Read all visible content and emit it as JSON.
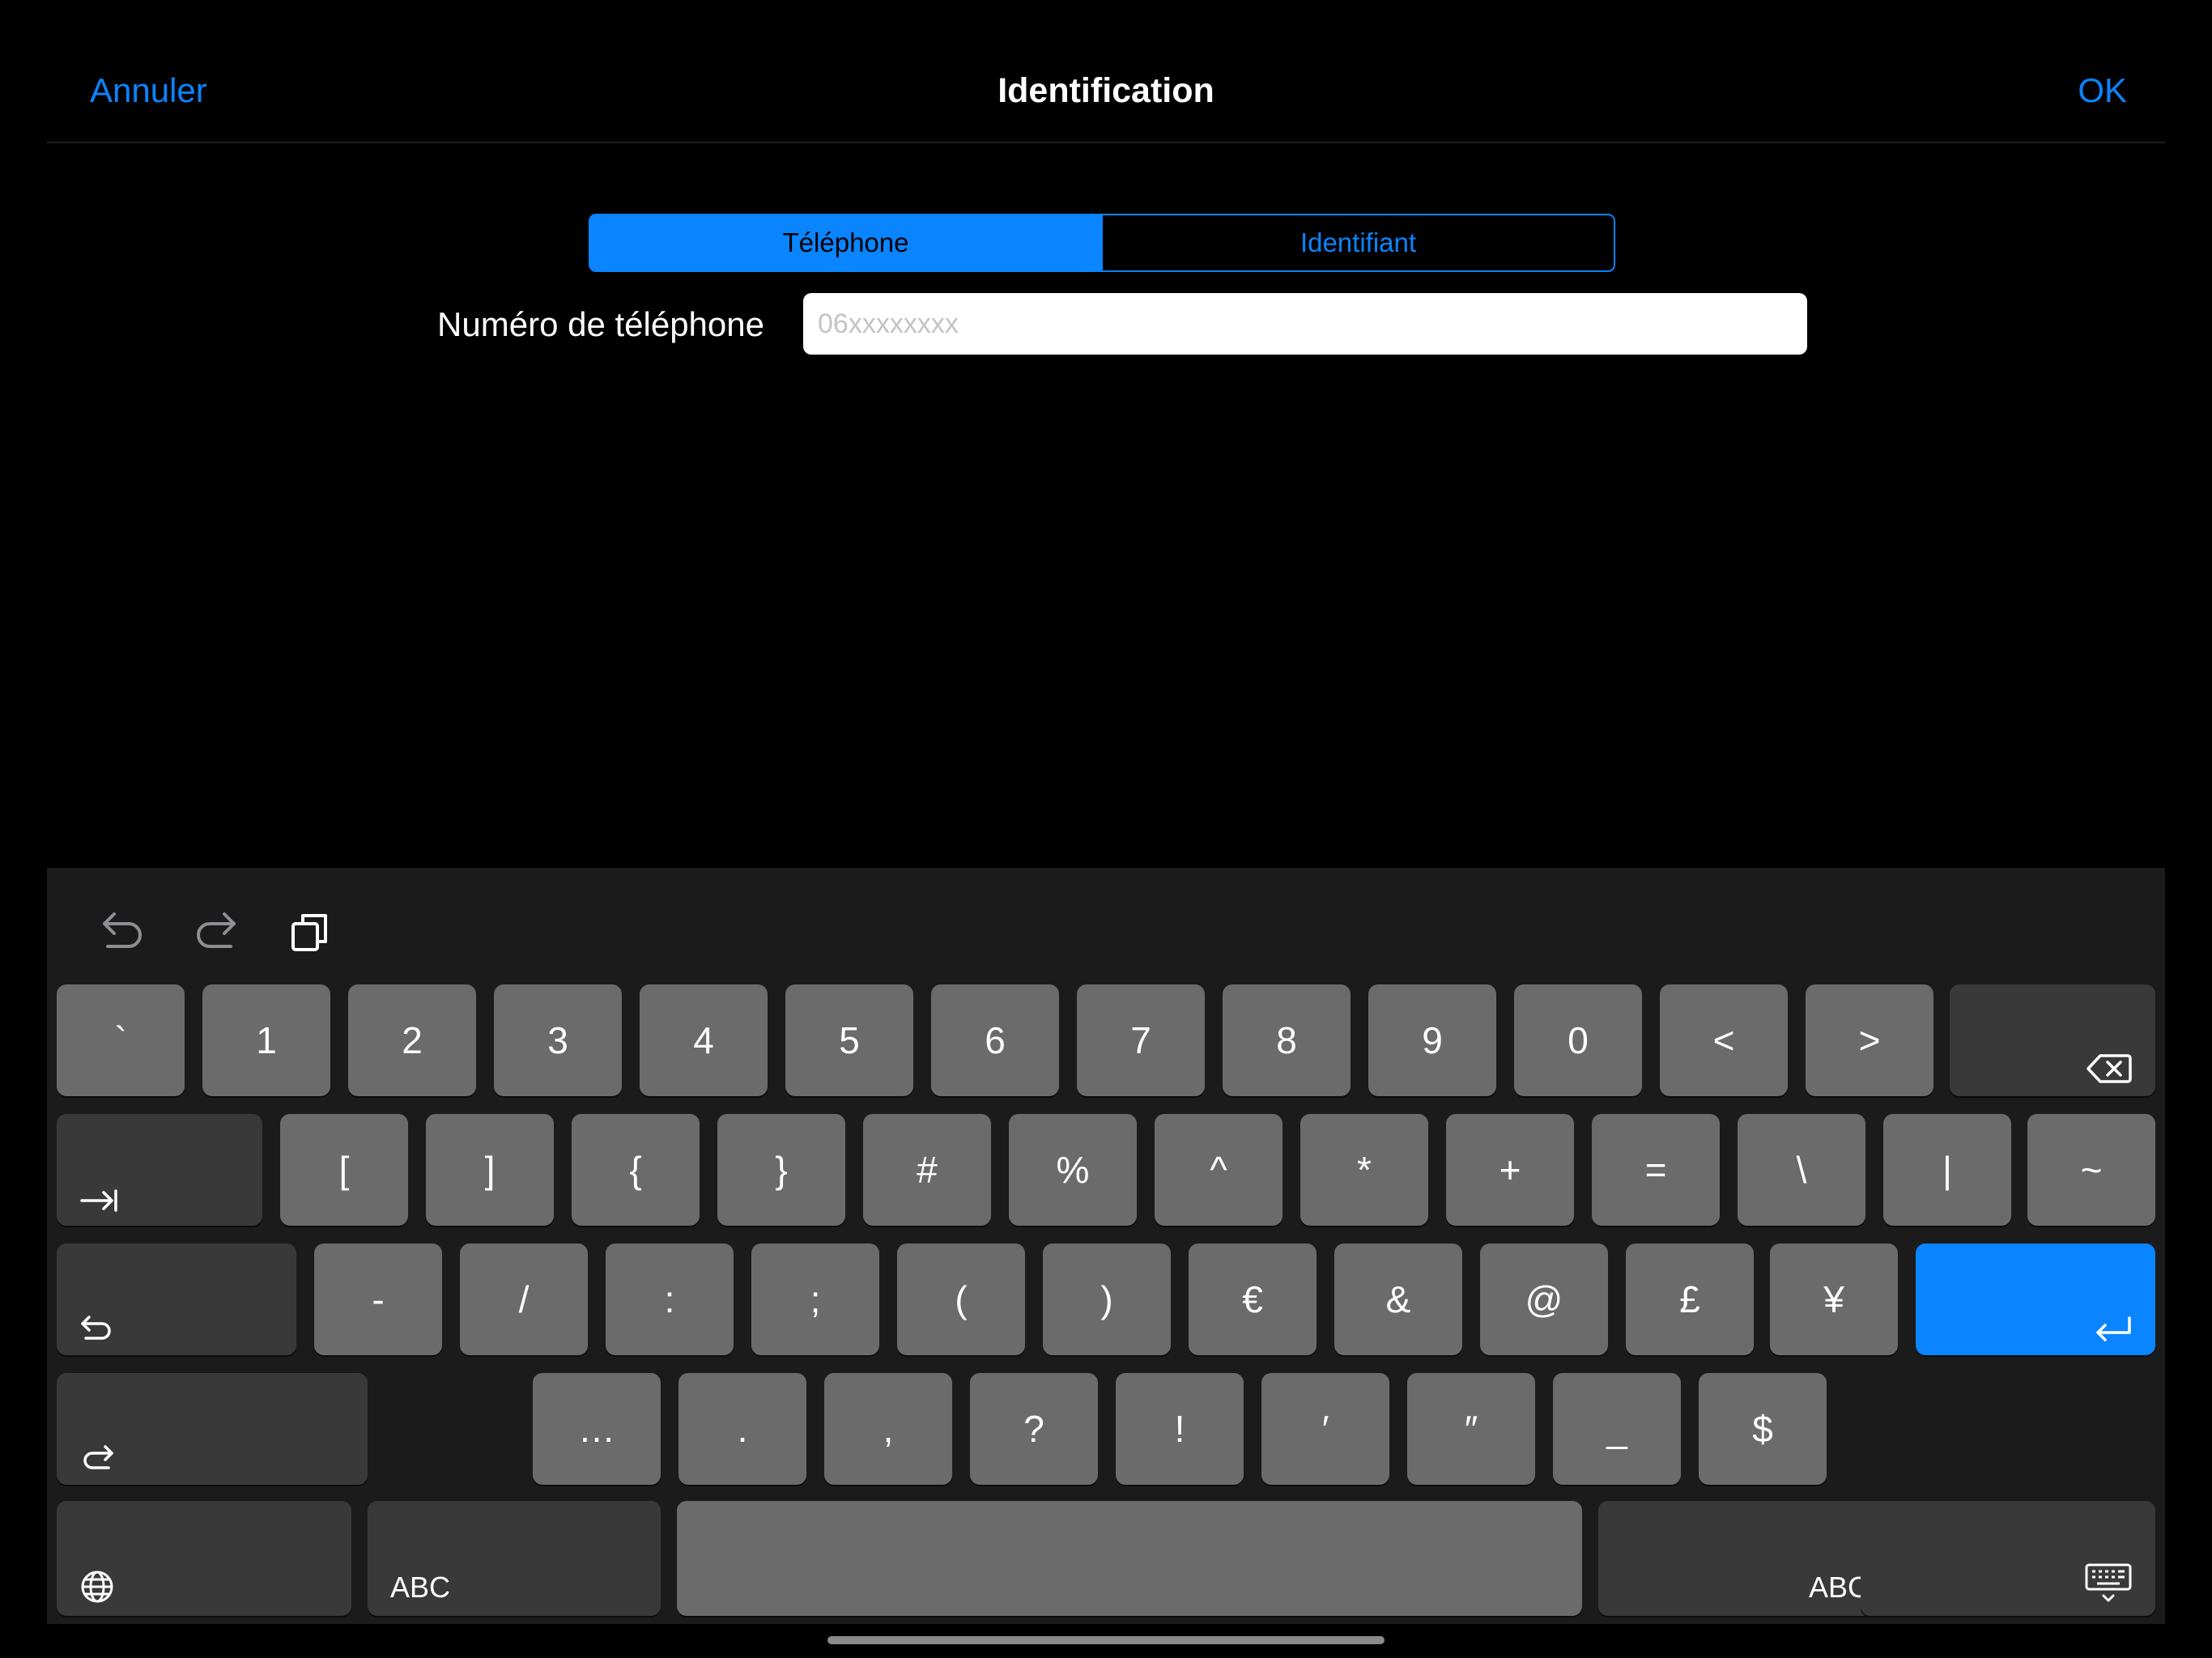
{
  "nav": {
    "cancel": "Annuler",
    "title": "Identification",
    "ok": "OK"
  },
  "segments": [
    {
      "label": "Téléphone",
      "selected": true
    },
    {
      "label": "Identifiant",
      "selected": false
    }
  ],
  "phone": {
    "label": "Numéro de téléphone",
    "placeholder": "06xxxxxxxx",
    "value": ""
  },
  "toolbar": {
    "undo": "undo-icon",
    "redo": "redo-icon",
    "paste": "paste-icon"
  },
  "keyboard": {
    "row1": [
      "`",
      "1",
      "2",
      "3",
      "4",
      "5",
      "6",
      "7",
      "8",
      "9",
      "0",
      "<",
      ">"
    ],
    "row2": [
      "[",
      "]",
      "{",
      "}",
      "#",
      "%",
      "^",
      "*",
      "+",
      "=",
      "\\",
      "|",
      "~"
    ],
    "row3": [
      "-",
      "/",
      ":",
      ";",
      "(",
      ")",
      "€",
      "&",
      "@",
      "£",
      "¥"
    ],
    "row4": [
      "…",
      ".",
      ",",
      "?",
      "!",
      "′",
      "″",
      "_",
      "$"
    ],
    "abc_left": "ABC",
    "abc_right": "ABC"
  },
  "colors": {
    "accent": "#0a84ff",
    "key": "#6b6b6b",
    "modifier_key": "#393939",
    "keyboard_bg": "#1b1b1b"
  }
}
